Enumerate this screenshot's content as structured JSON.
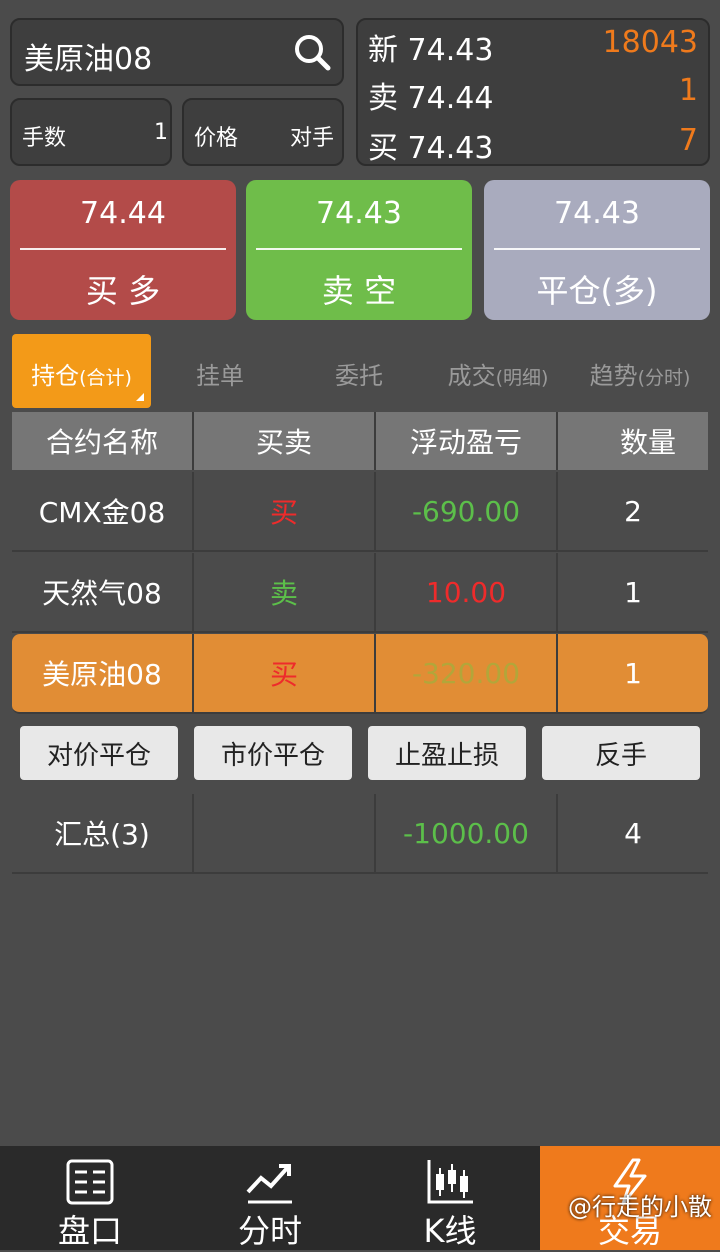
{
  "symbol": {
    "name": "美原油08",
    "search_icon": "search-icon"
  },
  "fields": {
    "lots_label": "手数",
    "lots_value": "1",
    "price_label": "价格",
    "price_value": "对手"
  },
  "quote": [
    {
      "label": "新 74.43",
      "value": "18043"
    },
    {
      "label": "卖 74.44",
      "value": "1"
    },
    {
      "label": "买 74.43",
      "value": "7"
    }
  ],
  "trade_buttons": [
    {
      "price": "74.44",
      "action": "买 多",
      "color": "#b34b49"
    },
    {
      "price": "74.43",
      "action": "卖 空",
      "color": "#6fbd4a"
    },
    {
      "price": "74.43",
      "action": "平仓(多)",
      "color": "#a9abbe"
    }
  ],
  "tabs": [
    {
      "label": "持仓",
      "sub": "(合计)"
    },
    {
      "label": "挂单",
      "sub": ""
    },
    {
      "label": "委托",
      "sub": ""
    },
    {
      "label": "成交",
      "sub": "(明细)"
    },
    {
      "label": "趋势",
      "sub": "(分时)"
    }
  ],
  "table": {
    "headers": [
      "合约名称",
      "买卖",
      "浮动盈亏",
      "数量"
    ],
    "rows": [
      {
        "name": "CMX金08",
        "side": "买",
        "pnl": "-690.00",
        "qty": "2"
      },
      {
        "name": "天然气08",
        "side": "卖",
        "pnl": "10.00",
        "qty": "1"
      },
      {
        "name": "美原油08",
        "side": "买",
        "pnl": "-320.00",
        "qty": "1"
      }
    ]
  },
  "actions": [
    "对价平仓",
    "市价平仓",
    "止盈止损",
    "反手"
  ],
  "summary": {
    "label": "汇总(3)",
    "pnl": "-1000.00",
    "qty": "4"
  },
  "nav": [
    {
      "label": "盘口",
      "icon": "order-book-icon"
    },
    {
      "label": "分时",
      "icon": "trend-chart-icon"
    },
    {
      "label": "K线",
      "icon": "candlestick-icon"
    },
    {
      "label": "交易",
      "icon": "lightning-icon"
    }
  ],
  "watermark": "@行走的小散",
  "colors": {
    "accent": "#ef7a1c",
    "up": "#ee2b2b",
    "down": "#5cbf4a",
    "tab_active": "#f39a18",
    "row_highlight": "#e18d35"
  }
}
